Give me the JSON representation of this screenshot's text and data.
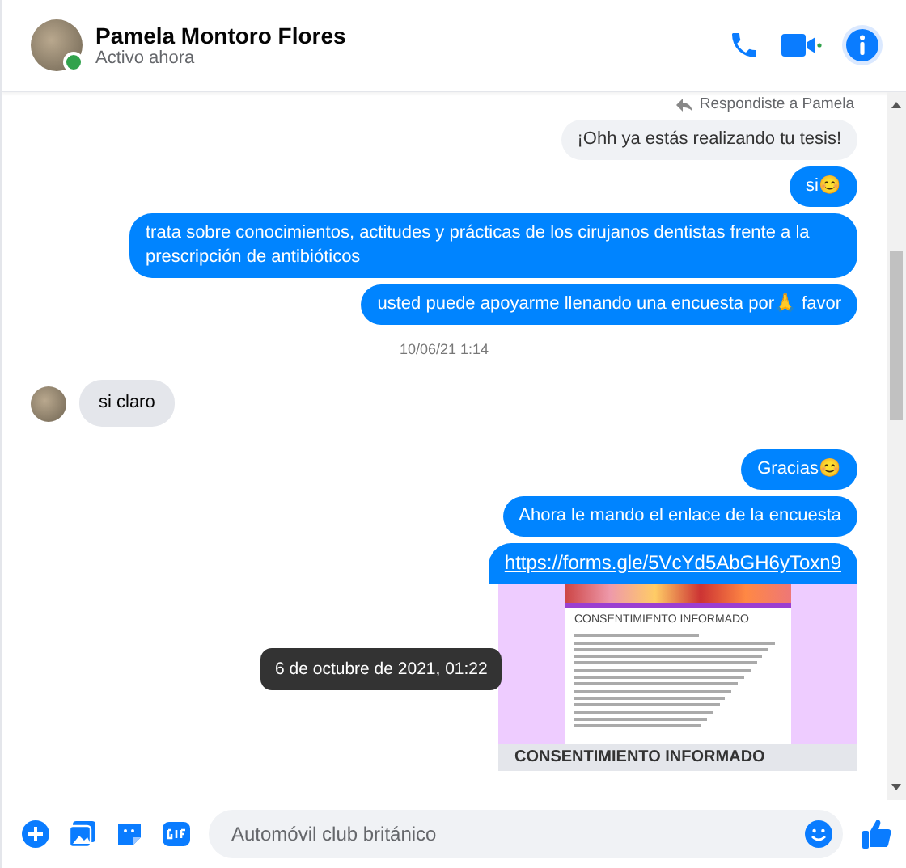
{
  "header": {
    "name": "Pamela Montoro Flores",
    "status": "Activo ahora",
    "online": true
  },
  "reply_note": "Respondiste a Pamela",
  "messages": [
    {
      "kind": "in-reply",
      "text": "¡Ohh ya estás realizando tu tesis!"
    },
    {
      "kind": "outgoing",
      "text": "si😊"
    },
    {
      "kind": "outgoing",
      "text": "trata sobre conocimientos, actitudes y prácticas de los cirujanos dentistas frente a la prescripción de antibióticos"
    },
    {
      "kind": "outgoing",
      "text": "usted puede apoyarme llenando una encuesta por🙏 favor"
    },
    {
      "kind": "timestamp",
      "text": "10/06/21 1:14"
    },
    {
      "kind": "incoming",
      "text": "si claro"
    },
    {
      "kind": "outgoing",
      "text": "Gracias😊"
    },
    {
      "kind": "outgoing",
      "text": "Ahora le mando el enlace de la encuesta"
    },
    {
      "kind": "link",
      "text": "https://forms.gle/5VcYd5AbGH6yToxn9"
    },
    {
      "kind": "preview",
      "text": "CONSENTIMIENTO INFORMADO",
      "caption": "CONSENTIMIENTO INFORMADO"
    }
  ],
  "tooltip": "6 de octubre de 2021, 01:22",
  "composer": {
    "placeholder": "Automóvil club británico"
  }
}
